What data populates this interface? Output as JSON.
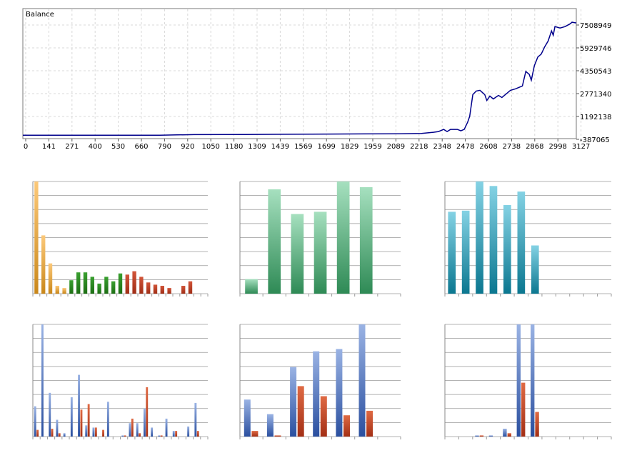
{
  "chart_data": [
    {
      "type": "line",
      "title": "Balance",
      "xticks": [
        "0",
        "141",
        "271",
        "400",
        "530",
        "660",
        "790",
        "920",
        "1050",
        "1180",
        "1309",
        "1439",
        "1569",
        "1699",
        "1829",
        "1959",
        "2089",
        "2218",
        "2348",
        "2478",
        "2608",
        "2738",
        "2868",
        "2998",
        "3127"
      ],
      "yticks": [
        "7508949",
        "5929746",
        "4350543",
        "2771340",
        "1192138",
        "-387065"
      ],
      "ylim": [
        -387065,
        7508949
      ],
      "xlim": [
        0,
        3235
      ],
      "grid": true,
      "color": "#00008b",
      "points": [
        [
          0,
          -100000
        ],
        [
          800,
          -100000
        ],
        [
          900,
          -80000
        ],
        [
          1000,
          -60000
        ],
        [
          1300,
          -50000
        ],
        [
          1800,
          -20000
        ],
        [
          2200,
          0
        ],
        [
          2330,
          20000
        ],
        [
          2400,
          100000
        ],
        [
          2430,
          150000
        ],
        [
          2460,
          300000
        ],
        [
          2480,
          150000
        ],
        [
          2500,
          300000
        ],
        [
          2540,
          300000
        ],
        [
          2560,
          200000
        ],
        [
          2580,
          300000
        ],
        [
          2600,
          800000
        ],
        [
          2612,
          1200000
        ],
        [
          2630,
          2700000
        ],
        [
          2650,
          2950000
        ],
        [
          2672,
          3000000
        ],
        [
          2700,
          2700000
        ],
        [
          2712,
          2300000
        ],
        [
          2730,
          2600000
        ],
        [
          2750,
          2400000
        ],
        [
          2780,
          2650000
        ],
        [
          2800,
          2500000
        ],
        [
          2830,
          2800000
        ],
        [
          2850,
          3000000
        ],
        [
          2880,
          3100000
        ],
        [
          2920,
          3300000
        ],
        [
          2940,
          4300000
        ],
        [
          2960,
          4100000
        ],
        [
          2972,
          3700000
        ],
        [
          2990,
          4700000
        ],
        [
          3010,
          5300000
        ],
        [
          3030,
          5500000
        ],
        [
          3050,
          6000000
        ],
        [
          3070,
          6400000
        ],
        [
          3090,
          7100000
        ],
        [
          3100,
          6800000
        ],
        [
          3110,
          7400000
        ],
        [
          3140,
          7300000
        ],
        [
          3170,
          7400000
        ],
        [
          3200,
          7600000
        ],
        [
          3210,
          7700000
        ],
        [
          3235,
          7650000
        ]
      ]
    },
    {
      "type": "bar",
      "title": "",
      "colors": [
        "#e8a030",
        "#e8a030",
        "#e8a030",
        "#e8a030",
        "#e8a030",
        "#2a8a1a",
        "#2a8a1a",
        "#2a8a1a",
        "#2a8a1a",
        "#2a8a1a",
        "#2a8a1a",
        "#2a8a1a",
        "#2a8a1a",
        "#c04020",
        "#c04020",
        "#c04020",
        "#c04020",
        "#c04020",
        "#c04020",
        "#c04020",
        "#c04020",
        "#c04020",
        "#c04020",
        "#e8a030",
        "#e8a030"
      ],
      "values": [
        1.0,
        0.52,
        0.27,
        0.07,
        0.05,
        0.12,
        0.19,
        0.19,
        0.15,
        0.09,
        0.15,
        0.11,
        0.18,
        0.17,
        0.2,
        0.15,
        0.1,
        0.08,
        0.07,
        0.05,
        0.0,
        0.07,
        0.11,
        0.0,
        0.0
      ],
      "ylim": [
        0,
        1
      ],
      "grid": true
    },
    {
      "type": "bar",
      "title": "",
      "color": "#4caf6e",
      "values": [
        0.13,
        0.93,
        0.71,
        0.73,
        1.0,
        0.95,
        0.0
      ],
      "ylim": [
        0,
        1
      ],
      "grid": true
    },
    {
      "type": "bar",
      "title": "",
      "color": "#28a0b8",
      "values": [
        0.73,
        0.74,
        1.0,
        0.96,
        0.79,
        0.91,
        0.43,
        0.0,
        0.0,
        0.0,
        0.0,
        0.0
      ],
      "ylim": [
        0,
        1
      ],
      "grid": true
    },
    {
      "type": "bar",
      "title": "",
      "series": [
        {
          "color": "#3a5faa",
          "values": [
            0.27,
            1.0,
            0.39,
            0.15,
            0.03,
            0.35,
            0.55,
            0.1,
            0.08,
            0.0,
            0.31,
            0.0,
            0.01,
            0.12,
            0.12,
            0.25,
            0.08,
            0.01,
            0.16,
            0.05,
            0.0,
            0.09,
            0.3,
            0.0
          ]
        },
        {
          "color": "#c03a22",
          "values": [
            0.06,
            0.0,
            0.07,
            0.03,
            0.0,
            0.0,
            0.24,
            0.29,
            0.08,
            0.06,
            0.0,
            0.0,
            0.01,
            0.16,
            0.03,
            0.44,
            0.0,
            0.01,
            0.0,
            0.05,
            0.0,
            0.0,
            0.05,
            0.0
          ]
        }
      ],
      "ylim": [
        0,
        1
      ],
      "grid": true
    },
    {
      "type": "bar",
      "title": "",
      "series": [
        {
          "color": "#3a5faa",
          "values": [
            0.33,
            0.2,
            0.62,
            0.76,
            0.78,
            1.0,
            0.0
          ]
        },
        {
          "color": "#c03a22",
          "values": [
            0.05,
            0.01,
            0.45,
            0.36,
            0.19,
            0.23,
            0.0
          ]
        }
      ],
      "ylim": [
        0,
        1
      ],
      "grid": true
    },
    {
      "type": "bar",
      "title": "",
      "series": [
        {
          "color": "#3a5faa",
          "values": [
            0.0,
            0.0,
            0.01,
            0.01,
            0.07,
            1.0,
            1.0,
            0.0,
            0.0,
            0.0,
            0.0,
            0.0
          ]
        },
        {
          "color": "#c03a22",
          "values": [
            0.0,
            0.0,
            0.01,
            0.0,
            0.03,
            0.48,
            0.22,
            0.0,
            0.0,
            0.0,
            0.0,
            0.0
          ]
        }
      ],
      "ylim": [
        0,
        1
      ],
      "grid": true
    }
  ]
}
